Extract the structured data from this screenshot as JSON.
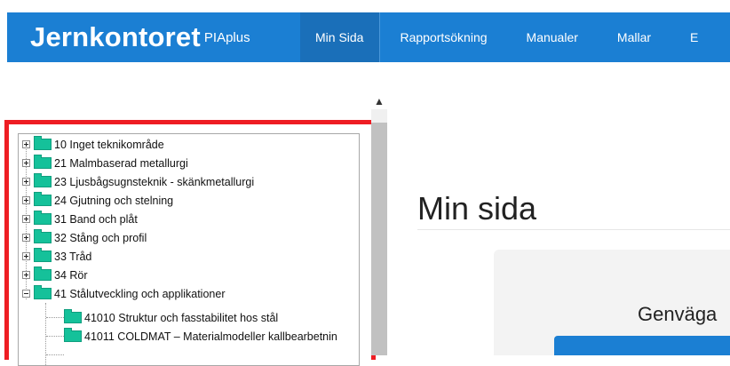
{
  "brand": {
    "name": "Jernkontoret",
    "suffix": "PIAplus"
  },
  "nav": {
    "items": [
      {
        "label": "Min Sida",
        "active": true
      },
      {
        "label": "Rapportsökning",
        "active": false
      },
      {
        "label": "Manualer",
        "active": false
      },
      {
        "label": "Mallar",
        "active": false
      },
      {
        "label": "E",
        "active": false
      }
    ]
  },
  "tree": {
    "nodes": [
      {
        "label": "10 Inget teknikområde",
        "expander": "plus"
      },
      {
        "label": "21 Malmbaserad metallurgi",
        "expander": "plus"
      },
      {
        "label": "23 Ljusbågsugnsteknik - skänkmetallurgi",
        "expander": "plus"
      },
      {
        "label": "24 Gjutning och stelning",
        "expander": "plus"
      },
      {
        "label": "31 Band och plåt",
        "expander": "plus"
      },
      {
        "label": "32 Stång och profil",
        "expander": "plus"
      },
      {
        "label": "33 Tråd",
        "expander": "plus"
      },
      {
        "label": "34 Rör",
        "expander": "plus"
      },
      {
        "label": "41 Stålutveckling och applikationer",
        "expander": "minus"
      }
    ],
    "children": [
      {
        "label": "41010 Struktur och fasstabilitet hos stål"
      },
      {
        "label": "41011 COLDMAT – Materialmodeller kallbearbetnin"
      }
    ]
  },
  "main": {
    "title": "Min sida",
    "card_heading": "Genväga"
  },
  "colors": {
    "navbar": "#1b7fd3",
    "highlight_border": "#ee1d23",
    "folder": "#15c19a"
  }
}
